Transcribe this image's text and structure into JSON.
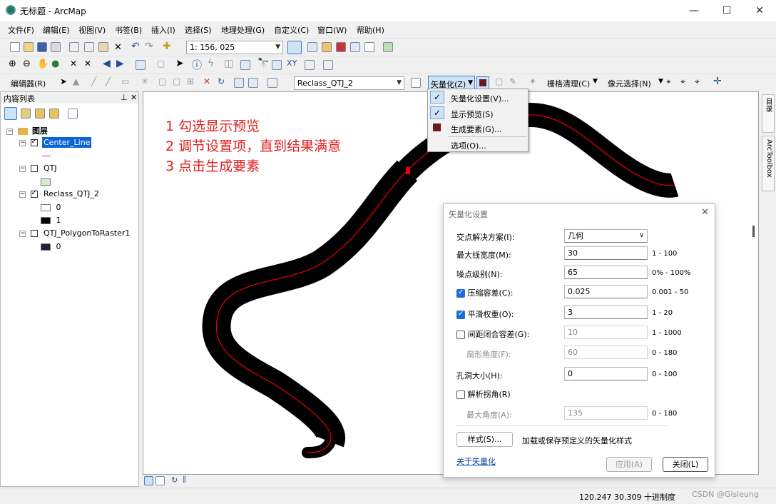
{
  "window": {
    "title": "无标题 - ArcMap",
    "min": "—",
    "max": "☐",
    "close": "✕"
  },
  "menu": [
    "文件(F)",
    "编辑(E)",
    "视图(V)",
    "书签(B)",
    "插入(I)",
    "选择(S)",
    "地理处理(G)",
    "自定义(C)",
    "窗口(W)",
    "帮助(H)"
  ],
  "toolbar": {
    "scale": "1: 156, 025",
    "editor": "编辑器(R)",
    "layer": "Reclass_QTJ_2",
    "vectorize": "矢量化(Z)",
    "raster_cleanup": "栅格清理(C)",
    "cell_select": "像元选择(N)"
  },
  "toc": {
    "title": "内容列表",
    "pin": "ᵖ",
    "close": "✕",
    "root": "图层",
    "layers": [
      {
        "name": "Center_Line",
        "checked": true
      },
      {
        "name": "QTJ",
        "checked": false
      },
      {
        "name": "Reclass_QTJ_2",
        "checked": true,
        "classes": [
          "0",
          "1"
        ]
      },
      {
        "name": "QTJ_PolygonToRaster1",
        "checked": false,
        "classes": [
          "0"
        ]
      }
    ]
  },
  "annotations": [
    "1 勾选显示预览",
    "2 调节设置项，直到结果满意",
    "3 点击生成要素"
  ],
  "dropdown": [
    {
      "label": "矢量化设置(V)...",
      "checked": true
    },
    {
      "label": "显示预览(S)",
      "checked": true
    },
    {
      "label": "生成要素(G)...",
      "checked": false
    },
    {
      "label": "选项(O)...",
      "checked": false
    }
  ],
  "dialog": {
    "title": "矢量化设置",
    "close": "✕",
    "rows": {
      "intersection": {
        "label": "交点解决方案(I):",
        "value": "几何"
      },
      "max_width": {
        "label": "最大线宽度(M):",
        "value": "30",
        "range": "1 - 100"
      },
      "noise": {
        "label": "噪点级别(N):",
        "value": "65",
        "range": "0% - 100%"
      },
      "compression": {
        "label": "压缩容差(C):",
        "value": "0.025",
        "range": "0.001 - 50",
        "checked": true
      },
      "smoothing": {
        "label": "平滑权重(O):",
        "value": "3",
        "range": "1 - 20",
        "checked": true
      },
      "gap": {
        "label": "间距闭合容差(G):",
        "value": "10",
        "range": "1 - 1000",
        "checked": false
      },
      "fan": {
        "label": "扇形角度(F):",
        "value": "60",
        "range": "0 - 180"
      },
      "hole": {
        "label": "孔洞大小(H):",
        "value": "0",
        "range": "0 - 100"
      },
      "corners": {
        "label": "解析拐角(R)",
        "checked": false
      },
      "max_angle": {
        "label": "最大角度(A):",
        "value": "135",
        "range": "0 - 180"
      }
    },
    "style_button": "样式(S)...",
    "style_desc": "加载或保存预定义的矢量化样式",
    "about_link": "关于矢量化",
    "apply": "应用(A)",
    "close_button": "关闭(L)"
  },
  "status": {
    "coords": "120.247  30.309 十进制度",
    "watermark": "CSDN @Gisleung"
  },
  "dock_tabs": [
    "目录",
    "ArcToolbox"
  ]
}
